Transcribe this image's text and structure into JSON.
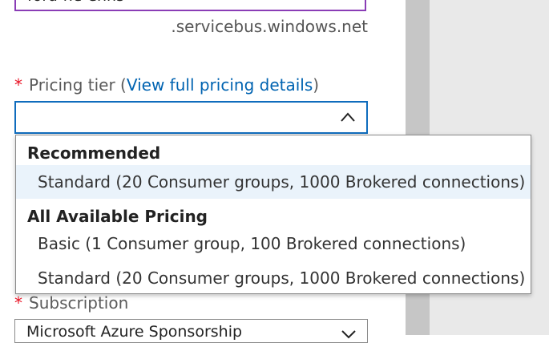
{
  "namespace": {
    "value": "ford-ne-ehns",
    "suffix": ".servicebus.windows.net"
  },
  "pricing_tier": {
    "required_mark": "*",
    "label_prefix": "Pricing tier (",
    "link_text": "View full pricing details",
    "label_suffix": ")",
    "selected_value": ""
  },
  "dropdown": {
    "groups": [
      {
        "header": "Recommended",
        "options": [
          "Standard (20 Consumer groups, 1000 Brokered connections)"
        ]
      },
      {
        "header": "All Available Pricing",
        "options": [
          "Basic (1 Consumer group, 100 Brokered connections)",
          "Standard (20 Consumer groups, 1000 Brokered connections)"
        ]
      }
    ]
  },
  "subscription": {
    "required_mark": "*",
    "label": "Subscription",
    "value": "Microsoft Azure Sponsorship"
  },
  "colors": {
    "accent": "#0f6cbd",
    "link": "#0063b1",
    "required": "#e81123",
    "valid": "#57a300",
    "highlight": "#eaf3fb"
  },
  "icons": {
    "valid": "checkmark-icon",
    "select_open": "chevron-up-icon",
    "select_closed": "chevron-down-icon"
  }
}
